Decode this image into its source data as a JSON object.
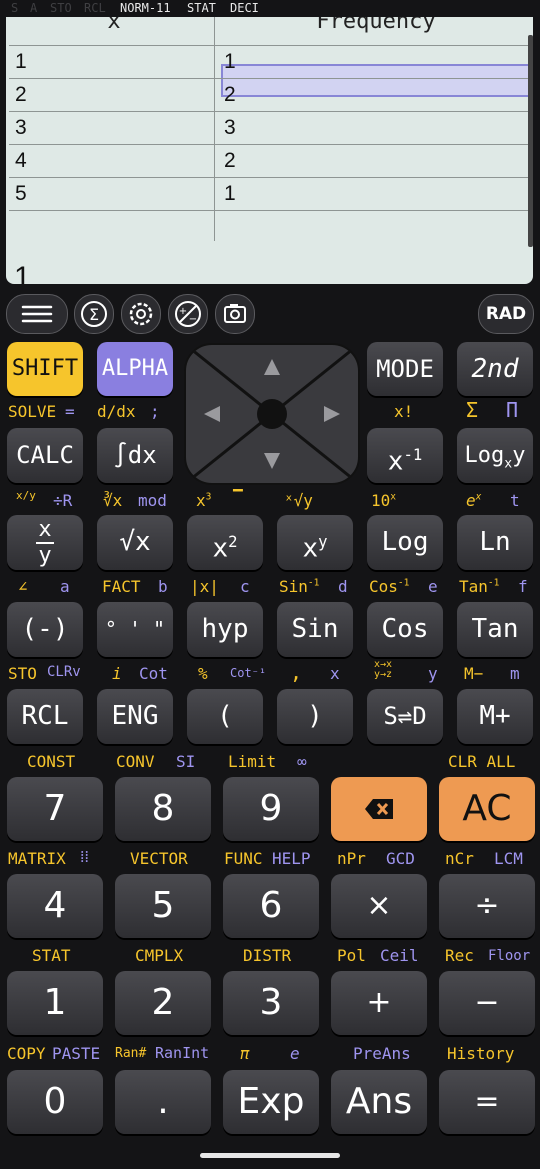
{
  "status_bar": {
    "s": "S",
    "a": "A",
    "sto": "STO",
    "rcl": "RCL",
    "mode": "NORM-11",
    "stat": "STAT",
    "deci": "DECI"
  },
  "table": {
    "headers": [
      "x",
      "Frequency"
    ],
    "rows": [
      [
        "1",
        "1"
      ],
      [
        "2",
        "2"
      ],
      [
        "3",
        "3"
      ],
      [
        "4",
        "2"
      ],
      [
        "5",
        "1"
      ],
      [
        "",
        ""
      ]
    ]
  },
  "entry_value": "1",
  "toolbar": {
    "icons": [
      "menu-icon",
      "sigma-icon",
      "gear-icon",
      "plus-minus-icon",
      "camera-icon"
    ],
    "angle_mode": "RAD"
  },
  "keys": {
    "shift": "SHIFT",
    "alpha": "ALPHA",
    "mode": "MODE",
    "second": "2nd",
    "calc": "CALC",
    "integral": "∫dx",
    "xinv": "x",
    "xinv_sup": "-1",
    "logxy": "Log",
    "frac_top": "x",
    "frac_bot": "y",
    "sqrt": "√x",
    "sq": "x",
    "sq_sup": "2",
    "pow": "x",
    "pow_sup": "y",
    "log": "Log",
    "ln": "Ln",
    "neg": "(-)",
    "deg": "° ' \"",
    "hyp": "hyp",
    "sin": "Sin",
    "cos": "Cos",
    "tan": "Tan",
    "rcl": "RCL",
    "eng": "ENG",
    "lparen": "(",
    "rparen": ")",
    "sd": "S⇌D",
    "mplus": "M+",
    "n7": "7",
    "n8": "8",
    "n9": "9",
    "ac": "AC",
    "n4": "4",
    "n5": "5",
    "n6": "6",
    "mul": "×",
    "div": "÷",
    "n1": "1",
    "n2": "2",
    "n3": "3",
    "plus": "+",
    "minus": "−",
    "n0": "0",
    "dot": ".",
    "exp": "Exp",
    "ans": "Ans",
    "eq": "="
  },
  "labels": {
    "solve": "SOLVE",
    "solve_eq": "=",
    "ddx": "d/dx",
    "semi": ";",
    "xfact": "x!",
    "sum": "Σ",
    "prod": "Π",
    "xy_frac": "x/y",
    "div_r": "÷R",
    "cbrt": "∛x",
    "mod": "mod",
    "x3": "x",
    "x3_sup": "3",
    "bar": "▔",
    "xrooty": "ˣ√y",
    "ten_x": "10",
    "ten_x_sup": "x",
    "e_x": "e",
    "e_x_sup": "x",
    "t": "t",
    "angle": "∠",
    "a": "a",
    "fact": "FACT",
    "b": "b",
    "abs": "|x|",
    "c": "c",
    "asin": "Sin",
    "asin_sup": "-1",
    "d": "d",
    "acos": "Cos",
    "acos_sup": "-1",
    "e": "e",
    "atan": "Tan",
    "atan_sup": "-1",
    "f": "f",
    "sto": "STO",
    "clrv": "CLRv",
    "i": "i",
    "cot": "Cot",
    "pct": "%",
    "acot": "Cot⁻¹",
    "comma": ",",
    "x": "x",
    "convert": "x→x",
    "convert_sub": "y→z",
    "y": "y",
    "mminus": "M−",
    "m": "m",
    "const": "CONST",
    "conv": "CONV",
    "si": "SI",
    "limit": "Limit",
    "inf": "∞",
    "clrall": "CLR ALL",
    "matrix": "MATRIX",
    "vector": "VECTOR",
    "func": "FUNC",
    "help": "HELP",
    "npr": "nPr",
    "gcd": "GCD",
    "ncr": "nCr",
    "lcm": "LCM",
    "stat": "STAT",
    "cmplx": "CMPLX",
    "distr": "DISTR",
    "pol": "Pol",
    "ceil": "Ceil",
    "rec": "Rec",
    "floor": "Floor",
    "copy": "COPY",
    "paste": "PASTE",
    "ran": "Ran#",
    "ranint": "RanInt",
    "pi": "π",
    "e_const": "e",
    "preans": "PreAns",
    "history": "History"
  },
  "colors": {
    "shift": "#f6c52c",
    "alpha": "#8a7fe0",
    "ac": "#ee9a52",
    "screen": "#dfe9e6",
    "selection": "#d2d3f2"
  }
}
